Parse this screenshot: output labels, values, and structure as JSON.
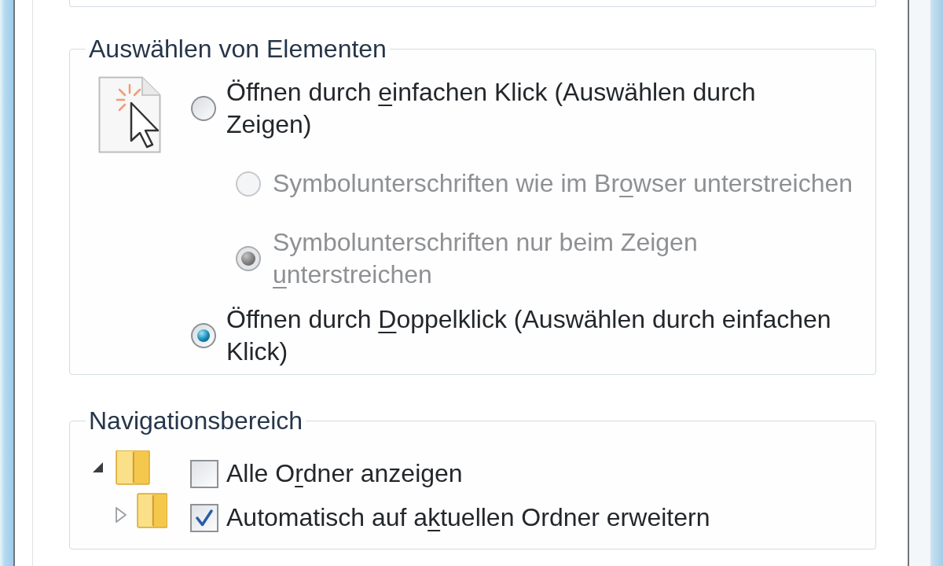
{
  "groups": [
    {
      "title": "Auswählen von Elementen",
      "kind": "radio",
      "options": [
        {
          "label_before": "Öffnen durch ",
          "access_key": "e",
          "label_after": "infachen Klick (Auswählen durch Zeigen)",
          "selected": false,
          "disabled": false,
          "sub_options": [
            {
              "label_before": "Symbolunterschriften wie im Br",
              "access_key": "o",
              "label_after": "wser unterstreichen",
              "selected": false,
              "disabled": true
            },
            {
              "label_before": "Symbolunterschriften nur beim Zeigen ",
              "access_key": "u",
              "label_after": "nterstreichen",
              "selected": true,
              "disabled": true
            }
          ]
        },
        {
          "label_before": "Öffnen durch ",
          "access_key": "D",
          "label_after": "oppelklick (Auswählen durch einfachen Klick)",
          "selected": true,
          "disabled": false
        }
      ]
    },
    {
      "title": "Navigationsbereich",
      "kind": "checkbox",
      "options": [
        {
          "label_before": "Alle O",
          "access_key": "r",
          "label_after": "dner anzeigen",
          "checked": false
        },
        {
          "label_before": "Automatisch auf a",
          "access_key": "k",
          "label_after": "tuellen Ordner erweitern",
          "checked": true
        }
      ]
    }
  ]
}
